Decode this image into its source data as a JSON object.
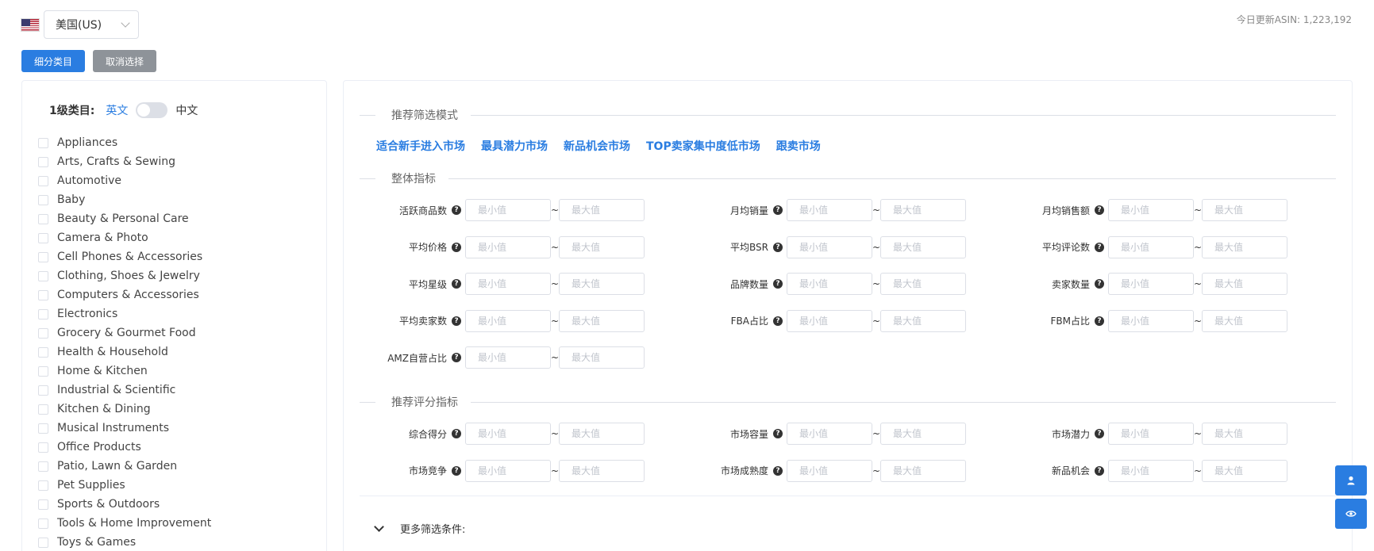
{
  "header": {
    "country_flag": "us-flag-icon",
    "country": "美国(US)",
    "asin_update": "今日更新ASIN: 1,223,192"
  },
  "actions": {
    "subdivide": "细分类目",
    "cancel": "取消选择"
  },
  "categories": {
    "level_label": "1级类目:",
    "lang_en": "英文",
    "lang_zh": "中文",
    "items": [
      "Appliances",
      "Arts, Crafts & Sewing",
      "Automotive",
      "Baby",
      "Beauty & Personal Care",
      "Camera & Photo",
      "Cell Phones & Accessories",
      "Clothing, Shoes & Jewelry",
      "Computers & Accessories",
      "Electronics",
      "Grocery & Gourmet Food",
      "Health & Household",
      "Home & Kitchen",
      "Industrial & Scientific",
      "Kitchen & Dining",
      "Musical Instruments",
      "Office Products",
      "Patio, Lawn & Garden",
      "Pet Supplies",
      "Sports & Outdoors",
      "Tools & Home Improvement",
      "Toys & Games"
    ]
  },
  "filters": {
    "recommend_title": "推荐筛选模式",
    "modes": [
      "适合新手进入市场",
      "最具潜力市场",
      "新品机会市场",
      "TOP卖家集中度低市场",
      "跟卖市场"
    ],
    "overall_title": "整体指标",
    "min_placeholder": "最小值",
    "max_placeholder": "最大值",
    "help_glyph": "?",
    "tilde": "~",
    "overall_metrics": [
      "活跃商品数",
      "月均销量",
      "月均销售额",
      "平均价格",
      "平均BSR",
      "平均评论数",
      "平均星级",
      "品牌数量",
      "卖家数量",
      "平均卖家数",
      "FBA占比",
      "FBM占比",
      "AMZ自营占比"
    ],
    "score_title": "推荐评分指标",
    "score_metrics": [
      "综合得分",
      "市场容量",
      "市场潜力",
      "市场竞争",
      "市场成熟度",
      "新品机会"
    ],
    "more": "更多筛选条件:"
  },
  "floating": {
    "user_icon": "user-icon",
    "eye_icon": "eye-icon"
  },
  "colors": {
    "primary": "#2a7de1",
    "gray_button": "#8e9399",
    "border": "#dcdfe6"
  }
}
